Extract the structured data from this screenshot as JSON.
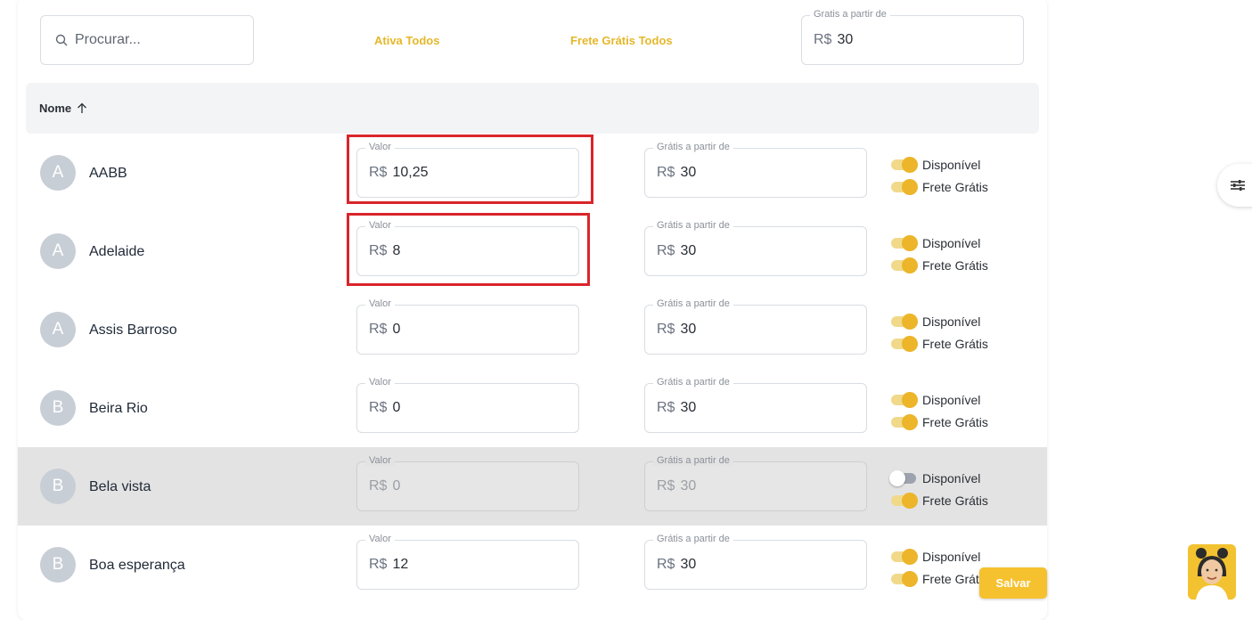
{
  "search": {
    "placeholder": "Procurar..."
  },
  "top_actions": {
    "activate_all": "Ativa Todos",
    "free_shipping_all": "Frete Grátis Todos"
  },
  "global_free_from": {
    "legend": "Gratis a partir de",
    "currency": "R$",
    "value": "30"
  },
  "table": {
    "column_name": "Nome",
    "rows": [
      {
        "initial": "A",
        "name": "AABB",
        "valor_legend": "Valor",
        "currency": "R$",
        "valor": "10,25",
        "gratis_legend": "Grátis a partir de",
        "gratis": "30",
        "disponivel_label": "Disponível",
        "disponivel_on": true,
        "frete_label": "Frete Grátis",
        "frete_on": true
      },
      {
        "initial": "A",
        "name": "Adelaide",
        "valor_legend": "Valor",
        "currency": "R$",
        "valor": "8",
        "gratis_legend": "Grátis a partir de",
        "gratis": "30",
        "disponivel_label": "Disponível",
        "disponivel_on": true,
        "frete_label": "Frete Grátis",
        "frete_on": true
      },
      {
        "initial": "A",
        "name": "Assis Barroso",
        "valor_legend": "Valor",
        "currency": "R$",
        "valor": "0",
        "gratis_legend": "Grátis a partir de",
        "gratis": "30",
        "disponivel_label": "Disponível",
        "disponivel_on": true,
        "frete_label": "Frete Grátis",
        "frete_on": true
      },
      {
        "initial": "B",
        "name": "Beira Rio",
        "valor_legend": "Valor",
        "currency": "R$",
        "valor": "0",
        "gratis_legend": "Grátis a partir de",
        "gratis": "30",
        "disponivel_label": "Disponível",
        "disponivel_on": true,
        "frete_label": "Frete Grátis",
        "frete_on": true
      },
      {
        "initial": "B",
        "name": "Bela vista",
        "valor_legend": "Valor",
        "currency": "R$",
        "valor": "0",
        "gratis_legend": "Grátis a partir de",
        "gratis": "30",
        "disponivel_label": "Disponível",
        "disponivel_on": false,
        "frete_label": "Frete Grátis",
        "frete_on": true
      },
      {
        "initial": "B",
        "name": "Boa esperança",
        "valor_legend": "Valor",
        "currency": "R$",
        "valor": "12",
        "gratis_legend": "Grátis a partir de",
        "gratis": "30",
        "disponivel_label": "Disponível",
        "disponivel_on": true,
        "frete_label": "Frete Grátis",
        "frete_on": true
      }
    ]
  },
  "save_button": "Salvar",
  "icons": {
    "search": "search-icon",
    "sort": "arrow-up-icon",
    "filter": "sliders-icon",
    "chat": "assistant-avatar-icon"
  },
  "colors": {
    "accent": "#f5c12e",
    "toggle_on": "#ecb52a",
    "highlight": "#d9252a",
    "disabled_row": "#e3e3e3"
  }
}
